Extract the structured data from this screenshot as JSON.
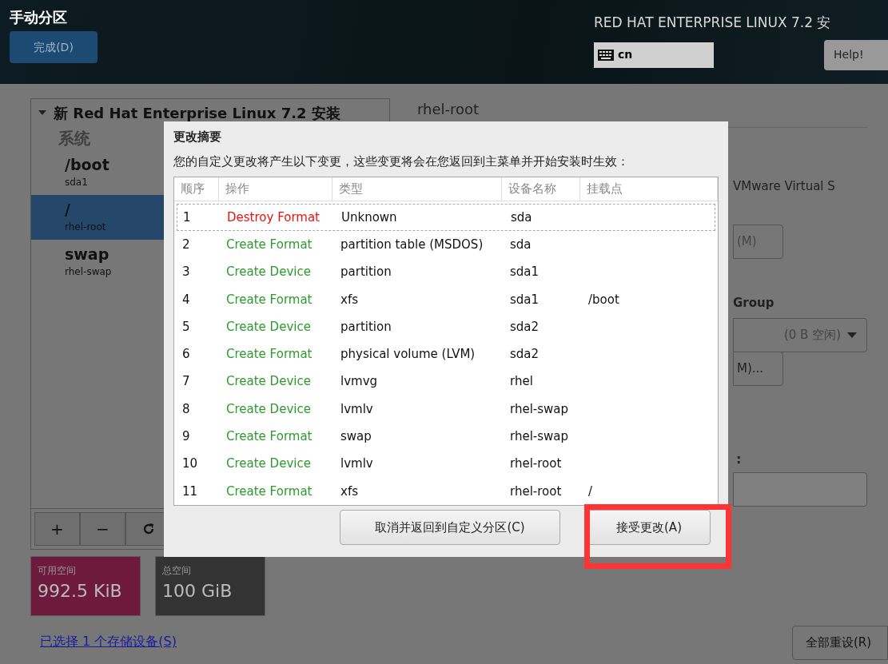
{
  "header": {
    "title": "手动分区",
    "done_button": "完成(D)",
    "product": "RED HAT ENTERPRISE LINUX 7.2 安",
    "keyboard": "cn",
    "help_button": "Help!"
  },
  "left_panel": {
    "install_title": "新 Red Hat Enterprise Linux 7.2 安装",
    "expanded": true,
    "category": "系统",
    "mounts": [
      {
        "mount": "/boot",
        "device": "sda1",
        "selected": false
      },
      {
        "mount": "/",
        "device": "rhel-root",
        "selected": true
      },
      {
        "mount": "swap",
        "device": "rhel-swap",
        "selected": false
      }
    ],
    "toolbar": [
      "+",
      "−"
    ]
  },
  "space": [
    {
      "label": "可用空间",
      "value": "992.5 KiB",
      "color": "#6e1a3c"
    },
    {
      "label": "总空间",
      "value": "100 GiB",
      "color": "#333333"
    }
  ],
  "storage_link": "已选择 1 个存储设备(S)",
  "right_panel": {
    "title": "rhel-root",
    "device_text": "VMware Virtual S",
    "modify_button": "(M)",
    "group_label": "Group",
    "group_dropdown": "(0 B 空闲)",
    "group_button": "M)...",
    "name_label": ":",
    "reset_button": "全部重设(R)"
  },
  "dialog": {
    "title": "更改摘要",
    "description": "您的自定义更改将产生以下变更，这些变更将会在您返回到主菜单并开始安装时生效：",
    "columns": [
      "顺序",
      "操作",
      "类型",
      "设备名称",
      "挂载点"
    ],
    "rows": [
      {
        "order": "1",
        "action": "Destroy Format",
        "kind": "destroy",
        "type": "Unknown",
        "device": "sda",
        "mount": "",
        "focused": true
      },
      {
        "order": "2",
        "action": "Create Format",
        "kind": "create",
        "type": "partition table (MSDOS)",
        "device": "sda",
        "mount": "",
        "focused": false
      },
      {
        "order": "3",
        "action": "Create Device",
        "kind": "create",
        "type": "partition",
        "device": "sda1",
        "mount": "",
        "focused": false
      },
      {
        "order": "4",
        "action": "Create Format",
        "kind": "create",
        "type": "xfs",
        "device": "sda1",
        "mount": "/boot",
        "focused": false
      },
      {
        "order": "5",
        "action": "Create Device",
        "kind": "create",
        "type": "partition",
        "device": "sda2",
        "mount": "",
        "focused": false
      },
      {
        "order": "6",
        "action": "Create Format",
        "kind": "create",
        "type": "physical volume (LVM)",
        "device": "sda2",
        "mount": "",
        "focused": false
      },
      {
        "order": "7",
        "action": "Create Device",
        "kind": "create",
        "type": "lvmvg",
        "device": "rhel",
        "mount": "",
        "focused": false
      },
      {
        "order": "8",
        "action": "Create Device",
        "kind": "create",
        "type": "lvmlv",
        "device": "rhel-swap",
        "mount": "",
        "focused": false
      },
      {
        "order": "9",
        "action": "Create Format",
        "kind": "create",
        "type": "swap",
        "device": "rhel-swap",
        "mount": "",
        "focused": false
      },
      {
        "order": "10",
        "action": "Create Device",
        "kind": "create",
        "type": "lvmlv",
        "device": "rhel-root",
        "mount": "",
        "focused": false
      },
      {
        "order": "11",
        "action": "Create Format",
        "kind": "create",
        "type": "xfs",
        "device": "rhel-root",
        "mount": "/",
        "focused": false
      }
    ],
    "cancel_button": "取消并返回到自定义分区(C)",
    "accept_button": "接受更改(A)",
    "accept_highlighted": true
  }
}
